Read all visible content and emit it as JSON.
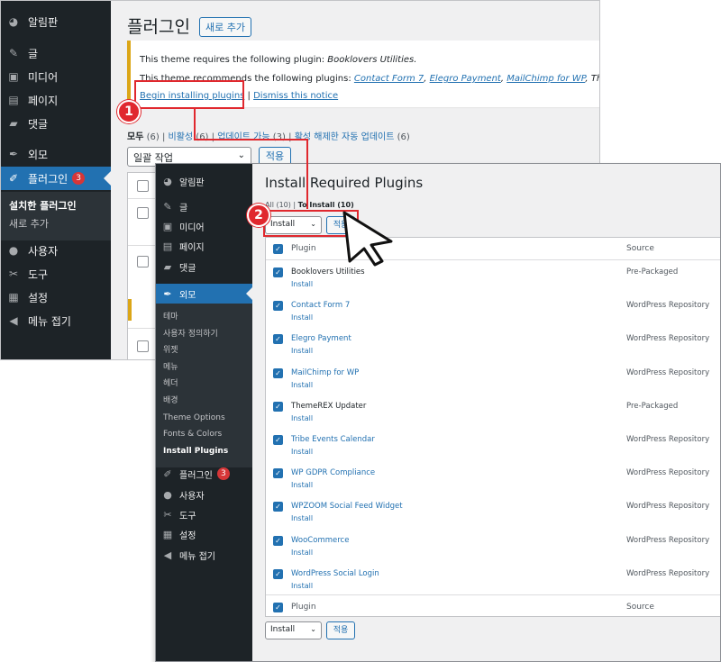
{
  "back": {
    "menu": [
      {
        "label": "알림판",
        "icon": "dashboard-icon",
        "glyph": "◕"
      },
      {
        "label": "글",
        "icon": "pin-icon",
        "glyph": "✎"
      },
      {
        "label": "미디어",
        "icon": "media-icon",
        "glyph": "▣"
      },
      {
        "label": "페이지",
        "icon": "pages-icon",
        "glyph": "▤"
      },
      {
        "label": "댓글",
        "icon": "comments-icon",
        "glyph": "▰"
      },
      {
        "label": "외모",
        "icon": "appearance-icon",
        "glyph": "✒"
      },
      {
        "label": "플러그인",
        "icon": "plugins-icon",
        "glyph": "✐",
        "badge": "3"
      },
      {
        "label": "사용자",
        "icon": "users-icon",
        "glyph": "●"
      },
      {
        "label": "도구",
        "icon": "tools-icon",
        "glyph": "✂"
      },
      {
        "label": "설정",
        "icon": "settings-icon",
        "glyph": "▦"
      },
      {
        "label": "메뉴 접기",
        "icon": "collapse-icon",
        "glyph": "◀"
      }
    ],
    "submenu": {
      "installed": "설치한 플러그인",
      "add_new": "새로 추가"
    },
    "page_title": "플러그인",
    "add_new_button": "새로 추가",
    "notice": {
      "line1_prefix": "This theme requires the following plugin: ",
      "line1_plugin": "Booklovers Utilities.",
      "line2_prefix": "This theme recommends the following plugins: ",
      "line2_links": [
        "Contact Form 7",
        "Elegro Payment",
        "MailChimp for WP"
      ],
      "line2_tail": "ThemeREX Up",
      "begin_link": "Begin installing plugins",
      "dismiss_link": "Dismiss this notice"
    },
    "filters": {
      "all": "모두",
      "all_count": "(6)",
      "inactive": "비활성",
      "inactive_count": "(6)",
      "update": "업데이트 가능",
      "update_count": "(3)",
      "auto_disabled": "활성 해제한 자동 업데이트",
      "auto_count": "(6)"
    },
    "bulk_select": "일괄 작업",
    "apply": "적용"
  },
  "front": {
    "menu": [
      {
        "label": "알림판",
        "icon": "dashboard-icon",
        "glyph": "◕"
      },
      {
        "label": "글",
        "icon": "pin-icon",
        "glyph": "✎"
      },
      {
        "label": "미디어",
        "icon": "media-icon",
        "glyph": "▣"
      },
      {
        "label": "페이지",
        "icon": "pages-icon",
        "glyph": "▤"
      },
      {
        "label": "댓글",
        "icon": "comments-icon",
        "glyph": "▰"
      },
      {
        "label": "외모",
        "icon": "appearance-icon",
        "glyph": "✒"
      },
      {
        "label": "플러그인",
        "icon": "plugins-icon",
        "glyph": "✐",
        "badge": "3"
      },
      {
        "label": "사용자",
        "icon": "users-icon",
        "glyph": "●"
      },
      {
        "label": "도구",
        "icon": "tools-icon",
        "glyph": "✂"
      },
      {
        "label": "설정",
        "icon": "settings-icon",
        "glyph": "▦"
      },
      {
        "label": "메뉴 접기",
        "icon": "collapse-icon",
        "glyph": "◀"
      }
    ],
    "appearance_submenu": [
      "테마",
      "사용자 정의하기",
      "위젯",
      "메뉴",
      "헤더",
      "배경",
      "Theme Options",
      "Fonts & Colors",
      "Install Plugins"
    ],
    "title": "Install Required Plugins",
    "sublinks": {
      "all": "All (10)",
      "to_install": "To Install (10)"
    },
    "bulk_select": "Install",
    "apply": "적용",
    "col_plugin": "Plugin",
    "col_source": "Source",
    "rows": [
      {
        "name": "Booklovers Utilities",
        "action": "Install",
        "source": "Pre-Packaged",
        "link": false
      },
      {
        "name": "Contact Form 7",
        "action": "Install",
        "source": "WordPress Repository",
        "link": true
      },
      {
        "name": "Elegro Payment",
        "action": "Install",
        "source": "WordPress Repository",
        "link": true
      },
      {
        "name": "MailChimp for WP",
        "action": "Install",
        "source": "WordPress Repository",
        "link": true
      },
      {
        "name": "ThemeREX Updater",
        "action": "Install",
        "source": "Pre-Packaged",
        "link": false
      },
      {
        "name": "Tribe Events Calendar",
        "action": "Install",
        "source": "WordPress Repository",
        "link": true
      },
      {
        "name": "WP GDPR Compliance",
        "action": "Install",
        "source": "WordPress Repository",
        "link": true
      },
      {
        "name": "WPZOOM Social Feed Widget",
        "action": "Install",
        "source": "WordPress Repository",
        "link": true
      },
      {
        "name": "WooCommerce",
        "action": "Install",
        "source": "WordPress Repository",
        "link": true
      },
      {
        "name": "WordPress Social Login",
        "action": "Install",
        "source": "WordPress Repository",
        "link": true
      }
    ]
  },
  "steps": [
    "1",
    "2"
  ],
  "colors": {
    "accent": "#2271b1",
    "sidebar": "#1d2327",
    "annotation": "#e0282e",
    "notice": "#dba617"
  }
}
